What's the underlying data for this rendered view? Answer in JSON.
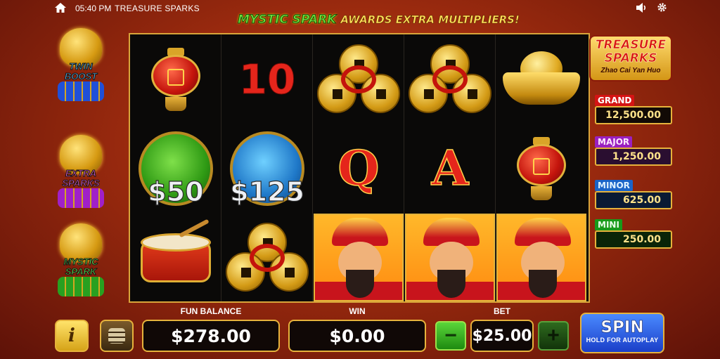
{
  "status_bar": {
    "time": "05:40 PM",
    "app_title": "TREASURE SPARKS"
  },
  "banner": {
    "feature": "MYSTIC SPARK",
    "text": "AWARDS EXTRA MULTIPLIERS!"
  },
  "features": [
    {
      "line1": "TWIN",
      "line2": "BOOST",
      "color": "#6ec8ff"
    },
    {
      "line1": "EXTRA",
      "line2": "SPARKS",
      "color": "#ff6ae6"
    },
    {
      "line1": "MYSTIC",
      "line2": "SPARK",
      "color": "#6dff5c"
    }
  ],
  "reels": [
    [
      "lantern",
      "jade-green $50",
      "drum"
    ],
    [
      "10",
      "jade-blue $125",
      "coins"
    ],
    [
      "coins",
      "Q",
      "god-of-wealth"
    ],
    [
      "coins",
      "A",
      "god-of-wealth"
    ],
    [
      "ingot",
      "lantern",
      "god-of-wealth"
    ]
  ],
  "symbols": {
    "ten": "10",
    "queen": "Q",
    "ace": "A",
    "cash1": "$50",
    "cash2": "$125"
  },
  "logo": {
    "line1": "TREASURE",
    "line2": "SPARKS",
    "tagline": "Zhao Cai Yan Huo"
  },
  "jackpots": {
    "grand": {
      "label": "GRAND",
      "value": "12,500.00"
    },
    "major": {
      "label": "MAJOR",
      "value": "1,250.00"
    },
    "minor": {
      "label": "MINOR",
      "value": "625.00"
    },
    "mini": {
      "label": "MINI",
      "value": "250.00"
    }
  },
  "controls": {
    "info_icon": "i",
    "balance_label": "FUN BALANCE",
    "balance_value": "$278.00",
    "win_label": "WIN",
    "win_value": "$0.00",
    "bet_label": "BET",
    "bet_value": "$25.00",
    "minus": "−",
    "plus": "+",
    "spin": "SPIN",
    "spin_sub": "HOLD FOR AUTOPLAY"
  },
  "icons": [
    "home-icon",
    "volume-icon",
    "gear-icon",
    "info-icon",
    "coin-stack-icon"
  ]
}
